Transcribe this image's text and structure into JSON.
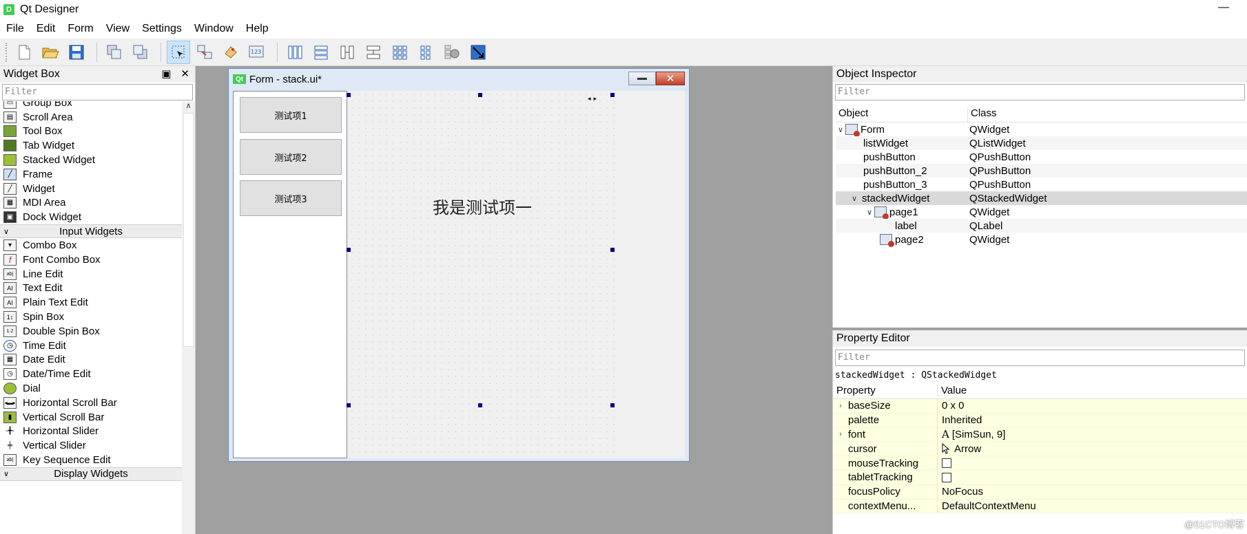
{
  "window": {
    "app_icon": "D",
    "title": "Qt Designer",
    "minimize": "—"
  },
  "menu": [
    "File",
    "Edit",
    "Form",
    "View",
    "Settings",
    "Window",
    "Help"
  ],
  "toolbar": {
    "icons": [
      "new-form-icon",
      "open-form-icon",
      "save-form-icon",
      "send-to-back-icon",
      "bring-to-front-icon",
      "edit-widgets-icon",
      "edit-signals-slots-icon",
      "edit-buddies-icon",
      "edit-tab-order-icon",
      "layout-horizontal-icon",
      "layout-vertical-icon",
      "layout-horizontal-splitter-icon",
      "layout-vertical-splitter-icon",
      "layout-grid-icon",
      "layout-form-icon",
      "break-layout-icon",
      "adjust-size-icon"
    ]
  },
  "widget_box": {
    "title": "Widget Box",
    "filter_placeholder": "Filter",
    "containers": [
      {
        "label": "Group Box",
        "icon": "group-box-icon"
      },
      {
        "label": "Scroll Area",
        "icon": "scroll-area-icon"
      },
      {
        "label": "Tool Box",
        "icon": "tool-box-icon"
      },
      {
        "label": "Tab Widget",
        "icon": "tab-widget-icon"
      },
      {
        "label": "Stacked Widget",
        "icon": "stacked-widget-icon"
      },
      {
        "label": "Frame",
        "icon": "frame-icon"
      },
      {
        "label": "Widget",
        "icon": "widget-icon"
      },
      {
        "label": "MDI Area",
        "icon": "mdi-area-icon"
      },
      {
        "label": "Dock Widget",
        "icon": "dock-widget-icon"
      }
    ],
    "input_category": "Input Widgets",
    "inputs": [
      {
        "label": "Combo Box",
        "icon": "combo-box-icon"
      },
      {
        "label": "Font Combo Box",
        "icon": "font-combo-box-icon"
      },
      {
        "label": "Line Edit",
        "icon": "line-edit-icon"
      },
      {
        "label": "Text Edit",
        "icon": "text-edit-icon"
      },
      {
        "label": "Plain Text Edit",
        "icon": "plain-text-edit-icon"
      },
      {
        "label": "Spin Box",
        "icon": "spin-box-icon"
      },
      {
        "label": "Double Spin Box",
        "icon": "double-spin-box-icon"
      },
      {
        "label": "Time Edit",
        "icon": "time-edit-icon"
      },
      {
        "label": "Date Edit",
        "icon": "date-edit-icon"
      },
      {
        "label": "Date/Time Edit",
        "icon": "date-time-edit-icon"
      },
      {
        "label": "Dial",
        "icon": "dial-icon"
      },
      {
        "label": "Horizontal Scroll Bar",
        "icon": "horizontal-scroll-bar-icon"
      },
      {
        "label": "Vertical Scroll Bar",
        "icon": "vertical-scroll-bar-icon"
      },
      {
        "label": "Horizontal Slider",
        "icon": "horizontal-slider-icon"
      },
      {
        "label": "Vertical Slider",
        "icon": "vertical-slider-icon"
      },
      {
        "label": "Key Sequence Edit",
        "icon": "key-sequence-edit-icon"
      }
    ],
    "display_category": "Display Widgets"
  },
  "form": {
    "qt_badge": "Qt",
    "title": "Form - stack.ui*",
    "buttons": [
      "测试项1",
      "测试项2",
      "测试项3"
    ],
    "stack_label": "我是测试项一"
  },
  "object_inspector": {
    "title": "Object Inspector",
    "filter_placeholder": "Filter",
    "columns": [
      "Object",
      "Class"
    ],
    "rows": [
      {
        "object": "Form",
        "class": "QWidget"
      },
      {
        "object": "listWidget",
        "class": "QListWidget"
      },
      {
        "object": "pushButton",
        "class": "QPushButton"
      },
      {
        "object": "pushButton_2",
        "class": "QPushButton"
      },
      {
        "object": "pushButton_3",
        "class": "QPushButton"
      },
      {
        "object": "stackedWidget",
        "class": "QStackedWidget"
      },
      {
        "object": "page1",
        "class": "QWidget"
      },
      {
        "object": "label",
        "class": "QLabel"
      },
      {
        "object": "page2",
        "class": "QWidget"
      }
    ]
  },
  "property_editor": {
    "title": "Property Editor",
    "filter_placeholder": "Filter",
    "class_line": "stackedWidget : QStackedWidget",
    "columns": [
      "Property",
      "Value"
    ],
    "rows": [
      {
        "property": "baseSize",
        "value": "0 x 0"
      },
      {
        "property": "palette",
        "value": "Inherited"
      },
      {
        "property": "font",
        "value": "[SimSun, 9]"
      },
      {
        "property": "cursor",
        "value": "Arrow"
      },
      {
        "property": "mouseTracking",
        "value": ""
      },
      {
        "property": "tabletTracking",
        "value": ""
      },
      {
        "property": "focusPolicy",
        "value": "NoFocus"
      },
      {
        "property": "contextMenu...",
        "value": "DefaultContextMenu"
      }
    ]
  },
  "watermark": "@51CTO博客"
}
